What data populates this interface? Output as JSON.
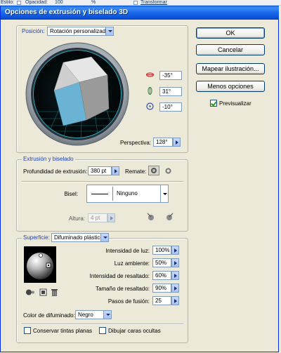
{
  "toolbar": {
    "estilo_label": "Estilo:",
    "opacidad_label": "Opacidad:",
    "opacidad_value": "100",
    "percent": "%",
    "transformar_label": "Transformar"
  },
  "dialog": {
    "title": "Opciones de extrusión y biselado 3D",
    "buttons": {
      "ok": "OK",
      "cancel": "Cancelar",
      "map": "Mapear ilustración...",
      "less": "Menos opciones"
    },
    "preview_label": "Previsualizar",
    "preview_checked": true
  },
  "position": {
    "label": "Posición:",
    "selected": "Rotación personalizada",
    "rot_x": "-35°",
    "rot_y": "31°",
    "rot_z": "-10°",
    "perspective_label": "Perspectiva:",
    "perspective_value": "128°"
  },
  "extrude": {
    "legend": "Extrusión y biselado",
    "depth_label": "Profundidad de extrusión:",
    "depth_value": "380 pt",
    "cap_label": "Remate:",
    "bevel_label": "Bisel:",
    "bevel_value": "Ninguno",
    "height_label": "Altura:",
    "height_value": "4 pt"
  },
  "surface": {
    "label": "Superficie:",
    "selected": "Difuminado plástico",
    "light_intensity_label": "Intensidad de luz:",
    "light_intensity_value": "100%",
    "ambient_label": "Luz ambiente:",
    "ambient_value": "50%",
    "highlight_intensity_label": "Intensidad de resaltado:",
    "highlight_intensity_value": "60%",
    "highlight_size_label": "Tamaño de resaltado:",
    "highlight_size_value": "90%",
    "blend_steps_label": "Pasos de fusión:",
    "blend_steps_value": "25",
    "shading_color_label": "Color de difuminado:",
    "shading_color_value": "Negro",
    "preserve_spot_label": "Conservar tintas planas",
    "preserve_spot_checked": false,
    "draw_hidden_label": "Dibujar caras ocultas",
    "draw_hidden_checked": false
  },
  "colors": {
    "title_bar": "#0b52d6",
    "dialog_bg": "#ece9d8",
    "legend_text": "#1d43c7",
    "cube_face": "#6bb3d4",
    "grid": "#1cc6c6"
  }
}
